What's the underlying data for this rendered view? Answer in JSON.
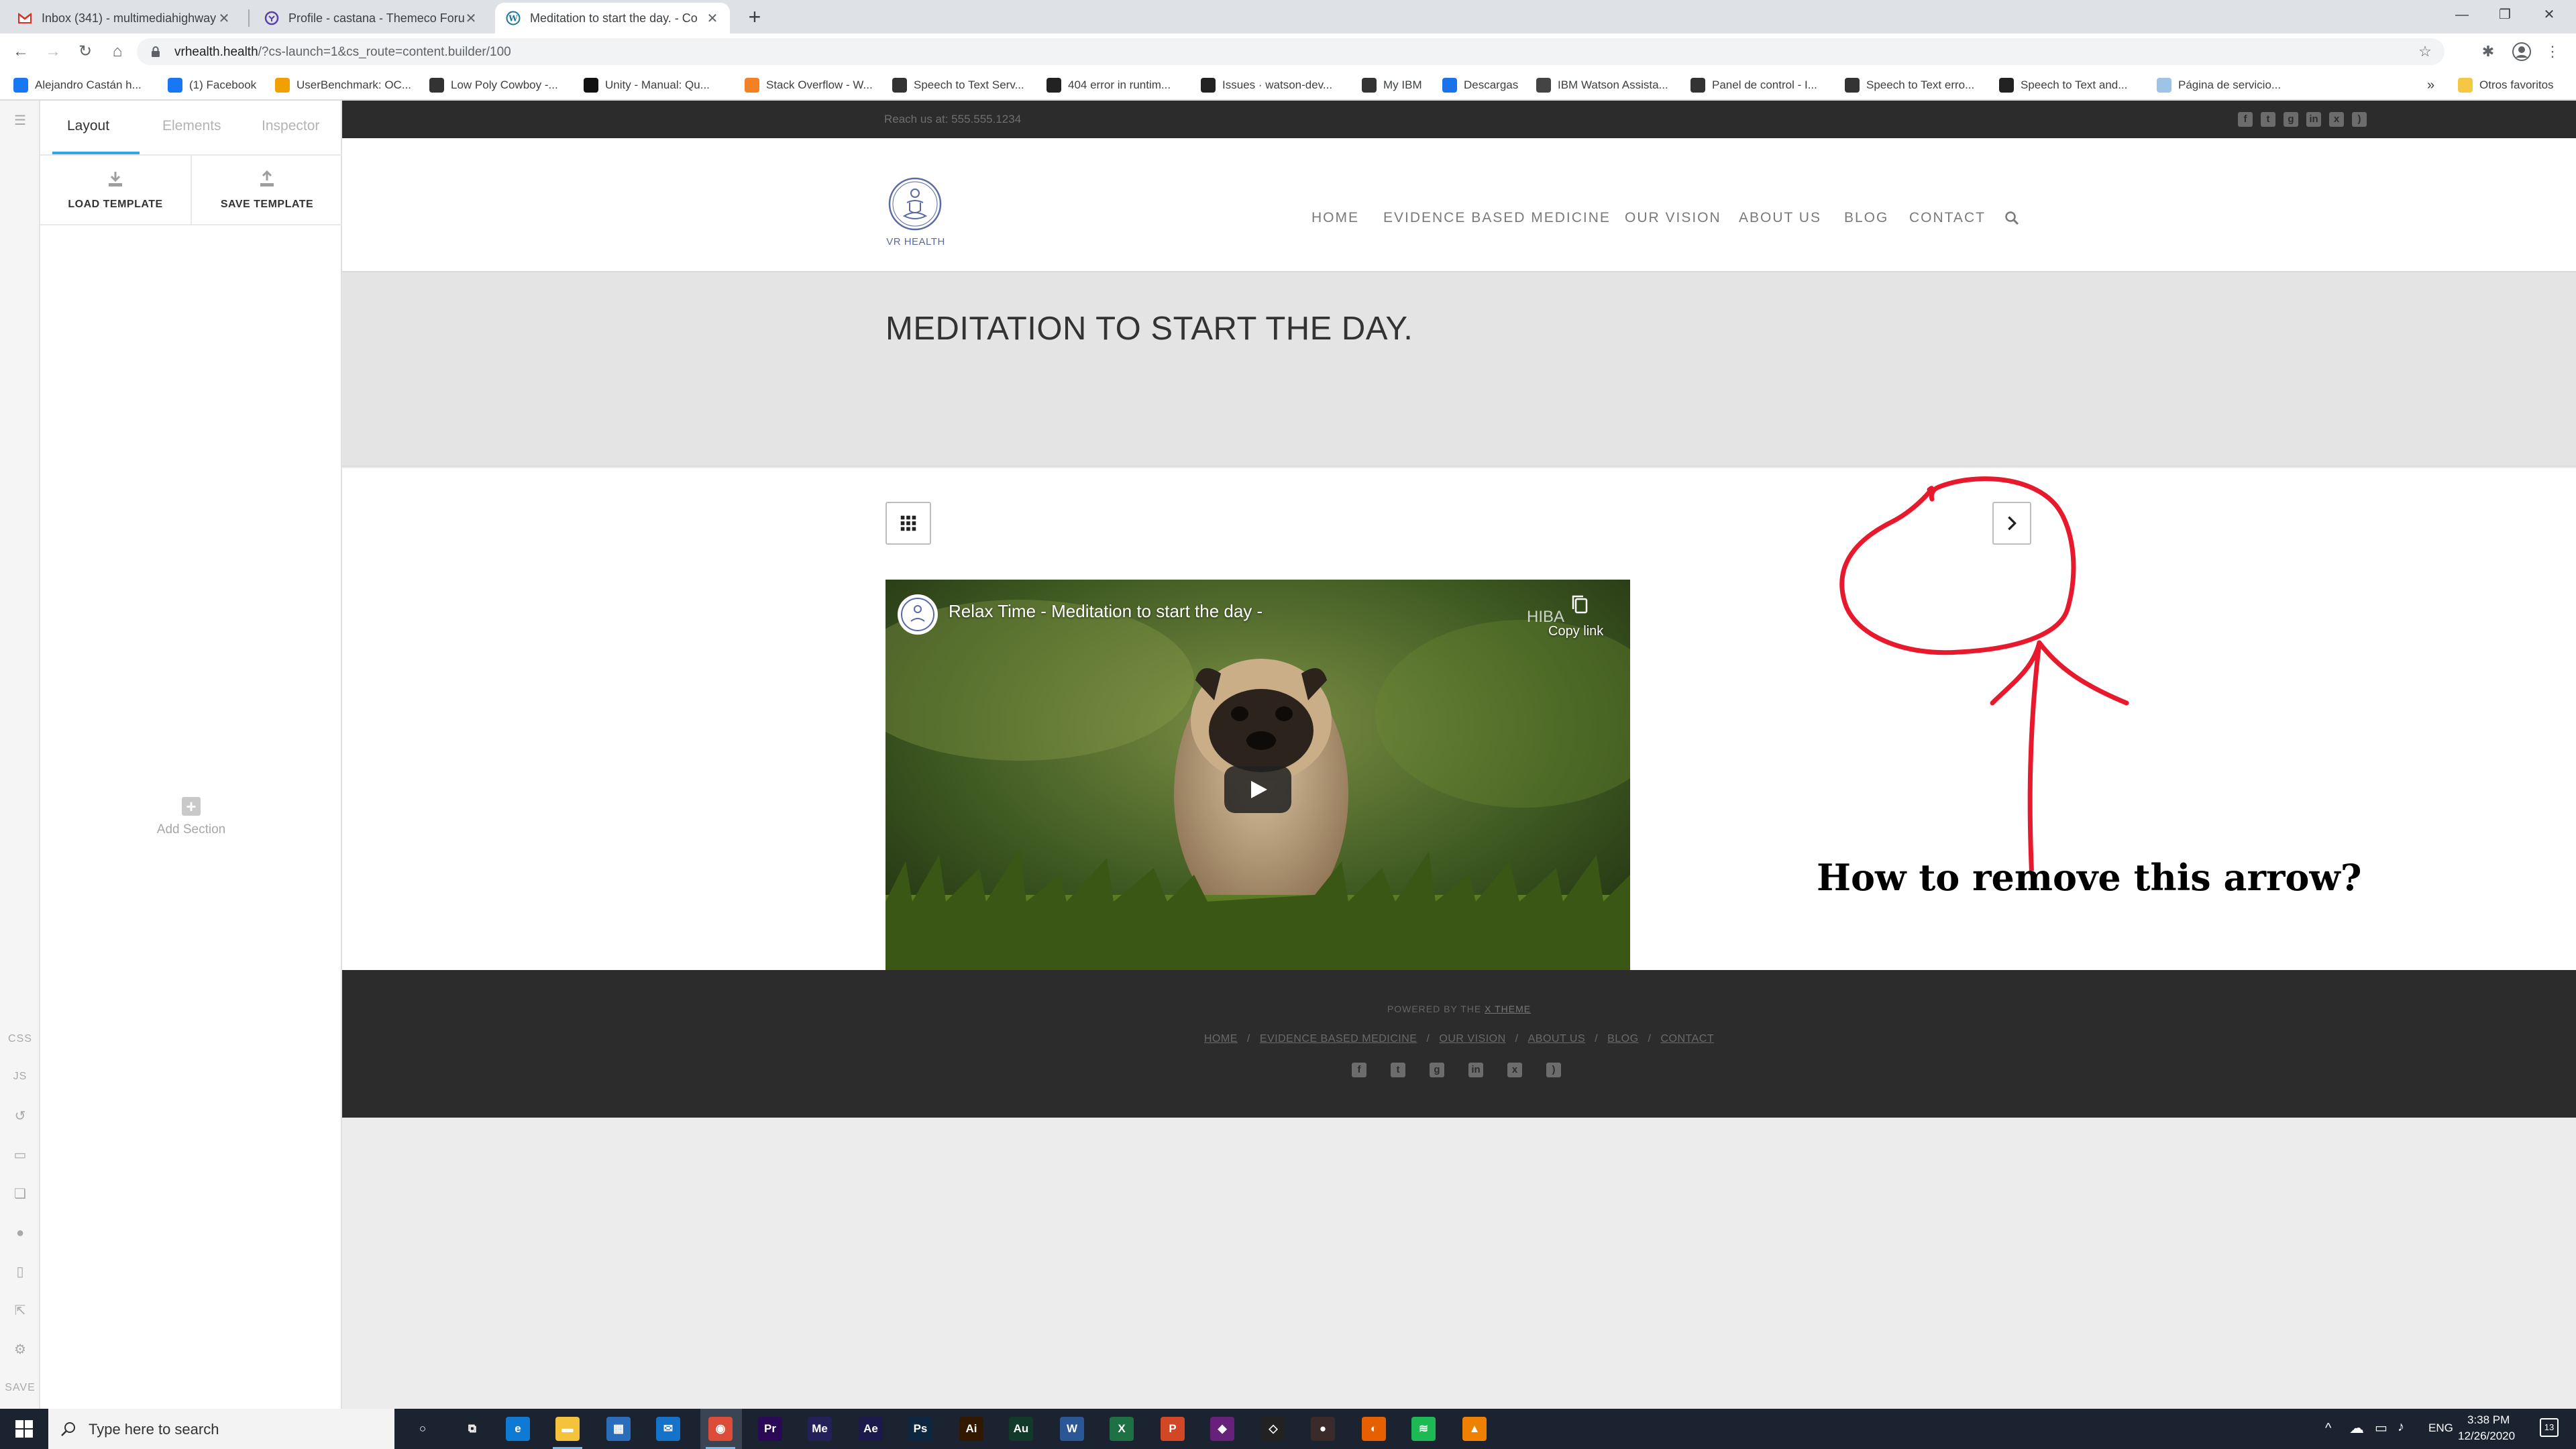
{
  "browser": {
    "tabs": [
      {
        "title": "Inbox (341) - multimediahighway",
        "favicon": "gmail-icon"
      },
      {
        "title": "Profile - castana - Themeco Foru",
        "favicon": "themeco-icon"
      },
      {
        "title": "Meditation to start the day. - Co",
        "favicon": "wordpress-icon",
        "active": true
      }
    ],
    "url_host": "vrhealth.health",
    "url_rest": "/?cs-launch=1&cs_route=content.builder/100",
    "bookmarks": [
      {
        "label": "Alejandro Castán h...",
        "icon": "facebook-icon",
        "color": "#1877f2"
      },
      {
        "label": "(1) Facebook",
        "icon": "facebook-icon",
        "color": "#1877f2"
      },
      {
        "label": "UserBenchmark: OC...",
        "icon": "userbenchmark-icon",
        "color": "#f0a000"
      },
      {
        "label": "Low Poly Cowboy -...",
        "icon": "unity-icon",
        "color": "#333333"
      },
      {
        "label": "Unity - Manual: Qu...",
        "icon": "unity-icon",
        "color": "#111111"
      },
      {
        "label": "Stack Overflow - W...",
        "icon": "stackoverflow-icon",
        "color": "#f48024"
      },
      {
        "label": "Speech to Text Serv...",
        "icon": "ibm-icon",
        "color": "#333333"
      },
      {
        "label": "404 error in runtim...",
        "icon": "github-icon",
        "color": "#222222"
      },
      {
        "label": "Issues · watson-dev...",
        "icon": "github-icon",
        "color": "#222222"
      },
      {
        "label": "My IBM",
        "icon": "ibm-icon",
        "color": "#333333"
      },
      {
        "label": "Descargas",
        "icon": "download-icon",
        "color": "#1a73e8"
      },
      {
        "label": "IBM Watson Assista...",
        "icon": "watson-icon",
        "color": "#444444"
      },
      {
        "label": "Panel de control - I...",
        "icon": "ibm-icon",
        "color": "#333333"
      },
      {
        "label": "Speech to Text erro...",
        "icon": "ibm-icon",
        "color": "#333333"
      },
      {
        "label": "Speech to Text and...",
        "icon": "github-icon",
        "color": "#222222"
      },
      {
        "label": "Página de servicio...",
        "icon": "cloud-icon",
        "color": "#9ec3e6"
      }
    ],
    "bookmarks_more": "»",
    "other_bookmarks": "Otros favoritos"
  },
  "builder": {
    "tabs": [
      "Layout",
      "Elements",
      "Inspector"
    ],
    "active_tab": "Layout",
    "load_template": "LOAD TEMPLATE",
    "save_template": "SAVE TEMPLATE",
    "add_section": "Add Section",
    "rail": {
      "css": "CSS",
      "js": "JS",
      "save": "SAVE"
    },
    "accent_color": "#2ea8e6"
  },
  "site": {
    "reach": "Reach us at: 555.555.1234",
    "brand": "VR HEALTH",
    "nav": [
      "HOME",
      "EVIDENCE BASED MEDICINE",
      "OUR VISION",
      "ABOUT US",
      "BLOG",
      "CONTACT"
    ],
    "page_title": "MEDITATION TO START THE DAY.",
    "video": {
      "title": "Relax Time - Meditation to start the day -",
      "watermark": "HIBA",
      "copy_link": "Copy link"
    },
    "annotation": {
      "question": "How to remove this arrow?",
      "color": "#e8192c"
    },
    "footer": {
      "powered_prefix": "POWERED BY THE",
      "powered_link": "X THEME",
      "nav": [
        "HOME",
        "EVIDENCE BASED MEDICINE",
        "OUR VISION",
        "ABOUT US",
        "BLOG",
        "CONTACT"
      ],
      "separator": "/"
    },
    "social_icons": [
      "facebook-icon",
      "twitter-icon",
      "google-plus-icon",
      "linkedin-icon",
      "xing-icon",
      "rss-icon"
    ]
  },
  "taskbar": {
    "search_placeholder": "Type here to search",
    "lang": "ENG",
    "time": "3:38 PM",
    "date": "12/26/2020",
    "notifications": "13"
  }
}
